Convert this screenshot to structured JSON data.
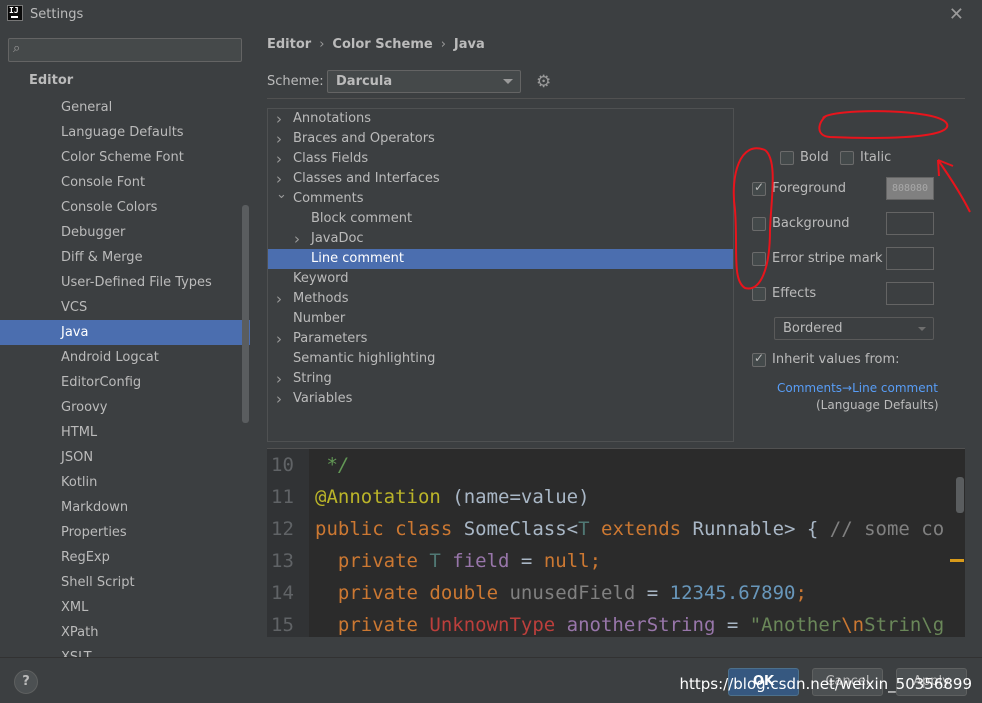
{
  "window": {
    "title": "Settings",
    "close_icon": "close-icon"
  },
  "sidebar": {
    "search_placeholder": "",
    "section": "Editor",
    "items": [
      "General",
      "Language Defaults",
      "Color Scheme Font",
      "Console Font",
      "Console Colors",
      "Debugger",
      "Diff & Merge",
      "User-Defined File Types",
      "VCS",
      "Java",
      "Android Logcat",
      "EditorConfig",
      "Groovy",
      "HTML",
      "JSON",
      "Kotlin",
      "Markdown",
      "Properties",
      "RegExp",
      "Shell Script",
      "XML",
      "XPath",
      "XSLT"
    ],
    "selected_index": 9
  },
  "breadcrumb": {
    "a": "Editor",
    "b": "Color Scheme",
    "c": "Java",
    "sep": "›"
  },
  "scheme": {
    "label": "Scheme:",
    "value": "Darcula"
  },
  "tree": [
    {
      "label": "Annotations",
      "expander": "collapsed",
      "depth": 0
    },
    {
      "label": "Braces and Operators",
      "expander": "collapsed",
      "depth": 0
    },
    {
      "label": "Class Fields",
      "expander": "collapsed",
      "depth": 0
    },
    {
      "label": "Classes and Interfaces",
      "expander": "collapsed",
      "depth": 0
    },
    {
      "label": "Comments",
      "expander": "expanded",
      "depth": 0
    },
    {
      "label": "Block comment",
      "expander": "none",
      "depth": 1
    },
    {
      "label": "JavaDoc",
      "expander": "collapsed",
      "depth": 1
    },
    {
      "label": "Line comment",
      "expander": "none",
      "depth": 1,
      "selected": true
    },
    {
      "label": "Keyword",
      "expander": "none",
      "depth": 0
    },
    {
      "label": "Methods",
      "expander": "collapsed",
      "depth": 0
    },
    {
      "label": "Number",
      "expander": "none",
      "depth": 0
    },
    {
      "label": "Parameters",
      "expander": "collapsed",
      "depth": 0
    },
    {
      "label": "Semantic highlighting",
      "expander": "none",
      "depth": 0
    },
    {
      "label": "String",
      "expander": "collapsed",
      "depth": 0
    },
    {
      "label": "Variables",
      "expander": "collapsed",
      "depth": 0
    }
  ],
  "props": {
    "bold": "Bold",
    "italic": "Italic",
    "foreground": "Foreground",
    "foreground_checked": true,
    "foreground_color": "808080",
    "background": "Background",
    "error_stripe": "Error stripe mark",
    "effects": "Effects",
    "effects_type": "Bordered",
    "inherit": "Inherit values from:",
    "inherit_checked": true,
    "inherit_link": "Comments→Line comment",
    "inherit_source": "(Language Defaults)"
  },
  "preview": {
    "lines": [
      {
        "n": "10",
        "parts": [
          {
            "t": " */",
            "c": "c-comment"
          }
        ]
      },
      {
        "n": "11",
        "parts": [
          {
            "t": "@Annotation",
            "c": "c-anno"
          },
          {
            "t": " (name=value)",
            "c": "c-plain"
          }
        ]
      },
      {
        "n": "12",
        "parts": [
          {
            "t": "public class ",
            "c": "c-kw"
          },
          {
            "t": "SomeClass<",
            "c": "c-plain"
          },
          {
            "t": "T ",
            "c": "c-type"
          },
          {
            "t": "extends ",
            "c": "c-kw"
          },
          {
            "t": "Runnable> { ",
            "c": "c-plain"
          },
          {
            "t": "// some co",
            "c": "c-gray"
          }
        ]
      },
      {
        "n": "13",
        "parts": [
          {
            "t": "  private ",
            "c": "c-kw"
          },
          {
            "t": "T ",
            "c": "c-type"
          },
          {
            "t": "field",
            "c": "c-field"
          },
          {
            "t": " = ",
            "c": "c-plain"
          },
          {
            "t": "null",
            "c": "c-kw"
          },
          {
            "t": ";",
            "c": "c-kw"
          }
        ]
      },
      {
        "n": "14",
        "parts": [
          {
            "t": "  private double ",
            "c": "c-kw"
          },
          {
            "t": "unusedField",
            "c": "c-gray"
          },
          {
            "t": " = ",
            "c": "c-plain"
          },
          {
            "t": "12345.67890",
            "c": "c-num"
          },
          {
            "t": ";",
            "c": "c-kw"
          }
        ]
      },
      {
        "n": "15",
        "parts": [
          {
            "t": "  private ",
            "c": "c-kw"
          },
          {
            "t": "UnknownType ",
            "c": "c-err"
          },
          {
            "t": "anotherString",
            "c": "c-field"
          },
          {
            "t": " = ",
            "c": "c-plain"
          },
          {
            "t": "\"Another",
            "c": "c-str"
          },
          {
            "t": "\\n",
            "c": "c-esc"
          },
          {
            "t": "Strin\\g",
            "c": "c-str"
          }
        ]
      }
    ]
  },
  "buttons": {
    "ok": "OK",
    "cancel": "Cancel",
    "apply": "Apply",
    "help": "?"
  },
  "watermark": "https://blog.csdn.net/weixin_50356899",
  "colors": {
    "selection": "#4b6eaf",
    "annotation_red": "#e8141c",
    "link": "#589df6"
  }
}
